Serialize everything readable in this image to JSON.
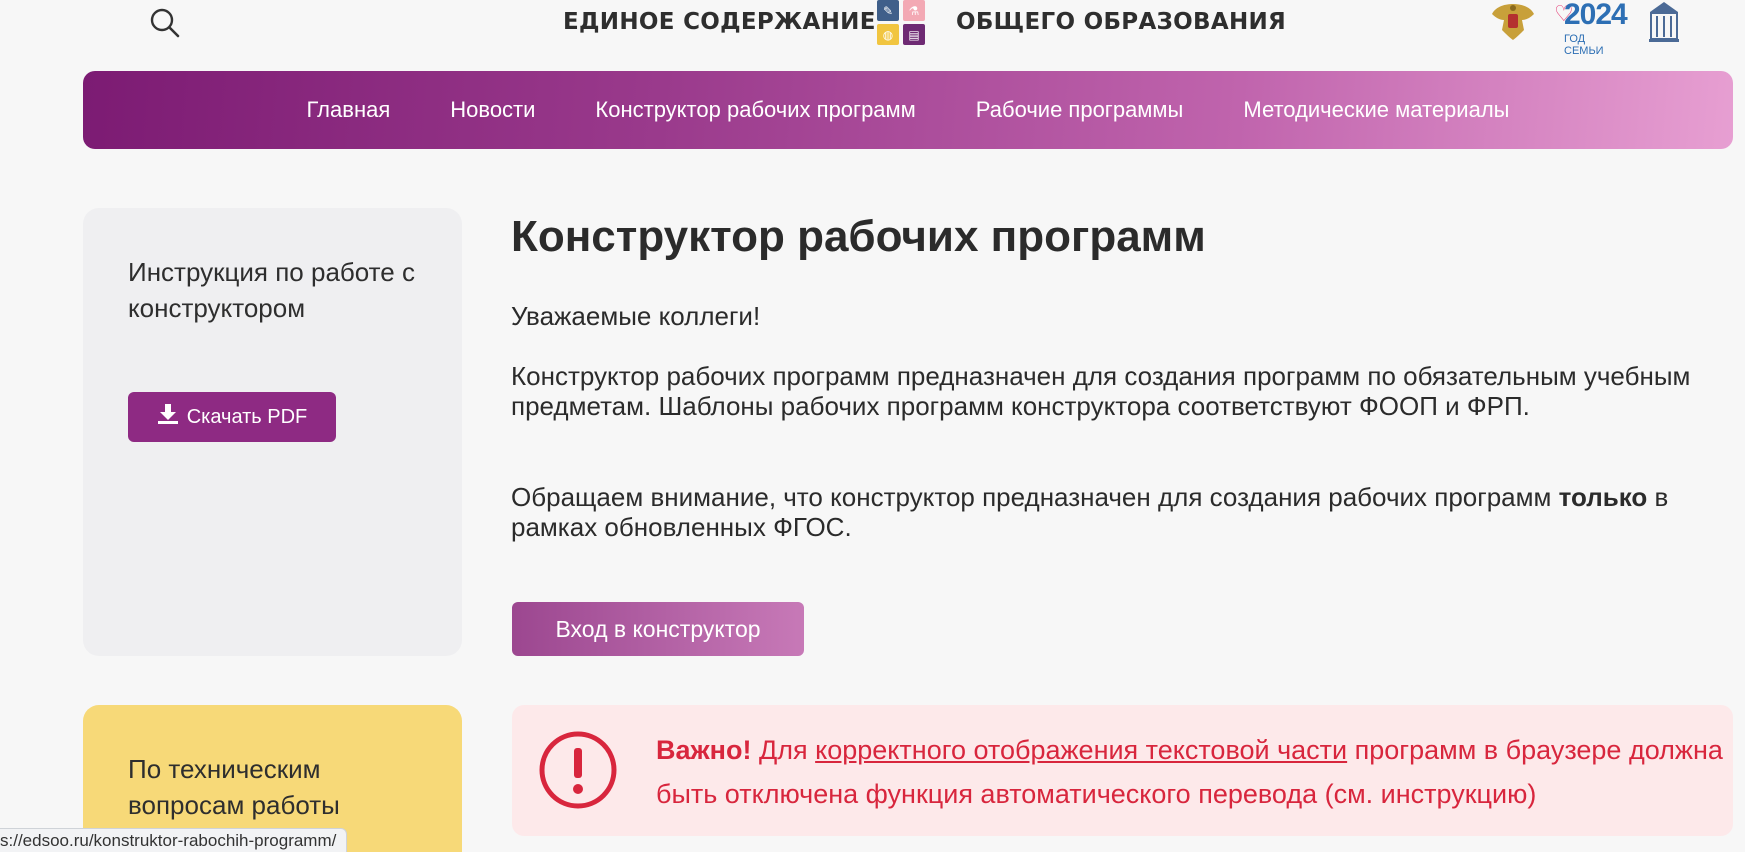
{
  "header": {
    "brand_left": "ЕДИНОЕ СОДЕРЖАНИЕ",
    "brand_right": "ОБЩЕГО ОБРАЗОВАНИЯ",
    "family_year": "2024",
    "family_caption": "ГОД СЕМЬИ",
    "icons": [
      "search-icon",
      "brand-logo",
      "coat-of-arms-logo",
      "family-year-logo",
      "building-logo"
    ]
  },
  "nav": {
    "items": [
      {
        "label": "Главная"
      },
      {
        "label": "Новости"
      },
      {
        "label": "Конструктор рабочих программ"
      },
      {
        "label": "Рабочие программы"
      },
      {
        "label": "Методические материалы"
      }
    ]
  },
  "sidebar": {
    "instruction_title": "Инструкция по работе с конструктором",
    "pdf_button": "Скачать PDF",
    "tech_title": "По техническим вопросам работы"
  },
  "main": {
    "title": "Конструктор рабочих программ",
    "greeting": "Уважаемые коллеги!",
    "description": "Конструктор рабочих программ предназначен для создания программ по обязательным учебным предметам. Шаблоны рабочих программ конструктора  соответствуют ФООП и ФРП.",
    "note_prefix": "Обращаем внимание, что  конструктор предназначен для создания рабочих программ ",
    "note_bold": "только",
    "note_suffix": " в рамках обновленных ФГОС.",
    "enter_button": "Вход в конструктор"
  },
  "warning": {
    "strong": "Важно!",
    "text_before": " Для ",
    "link": "корректного отображения текстовой части",
    "text_after": " программ в браузере должна быть отключена функция автоматического перевода (см. инструкцию)"
  },
  "status_url": "s://edsoo.ru/konstruktor-rabochih-programm/",
  "colors": {
    "nav_gradient_start": "#7c1b73",
    "nav_gradient_end": "#e79fd2",
    "pdf_button": "#8e2a83",
    "warning_text": "#d8263d",
    "warning_bg": "#fde9ea",
    "tech_card_bg": "#f7d978"
  }
}
